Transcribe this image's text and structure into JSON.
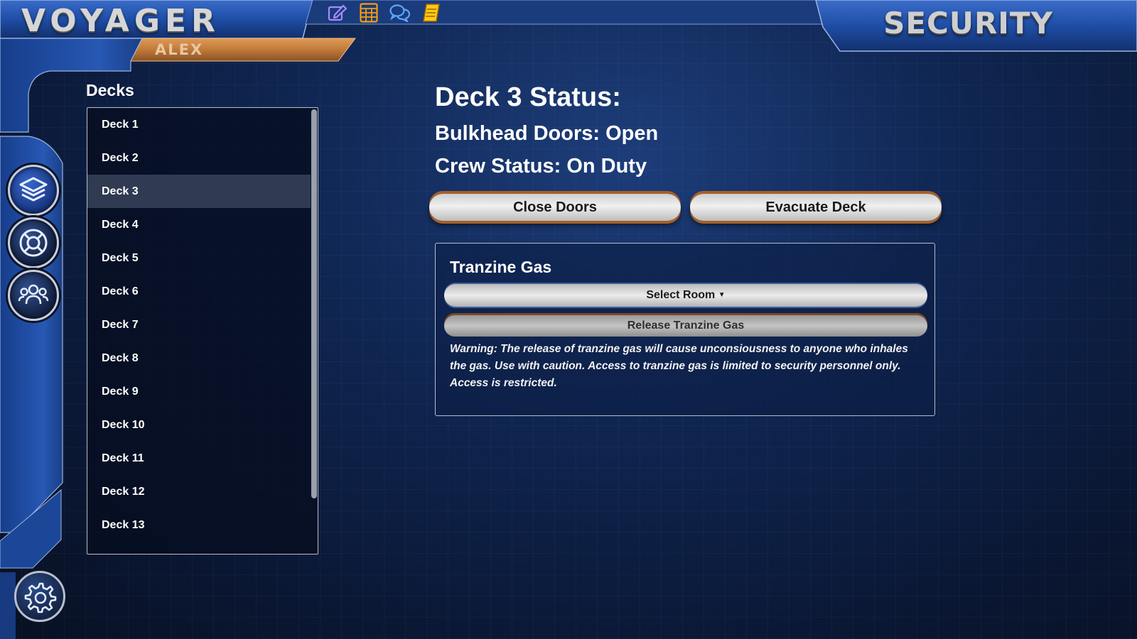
{
  "app": {
    "title": "VOYAGER",
    "user": "ALEX",
    "section": "SECURITY"
  },
  "toolbar": {
    "icons": [
      "pencil-edit-icon",
      "calculator-icon",
      "chat-bubbles-icon",
      "notebook-icon"
    ]
  },
  "rail": {
    "items": [
      "layers-icon",
      "lifebuoy-icon",
      "crew-icon"
    ],
    "active": "layers-icon",
    "settings_icon": "gear-icon"
  },
  "decks": {
    "heading": "Decks",
    "items": [
      "Deck 1",
      "Deck 2",
      "Deck 3",
      "Deck 4",
      "Deck 5",
      "Deck 6",
      "Deck 7",
      "Deck 8",
      "Deck 9",
      "Deck 10",
      "Deck 11",
      "Deck 12",
      "Deck 13"
    ],
    "selected": "Deck 3"
  },
  "status": {
    "title": "Deck 3 Status:",
    "bulkhead": "Bulkhead Doors: Open",
    "crew": "Crew Status: On Duty"
  },
  "actions": {
    "close_doors": "Close Doors",
    "evacuate": "Evacuate Deck"
  },
  "gas": {
    "title": "Tranzine Gas",
    "select_room": "Select Room",
    "release": "Release Tranzine Gas",
    "warning": "Warning: The release of tranzine gas will cause unconsiousness to anyone who inhales the gas. Use with caution. Access to tranzine gas is limited to security personnel only. Access is restricted."
  },
  "colors": {
    "accent_orange": "#c07a3a",
    "frame_blue": "#1f4ea6",
    "background": "#0f2550"
  }
}
